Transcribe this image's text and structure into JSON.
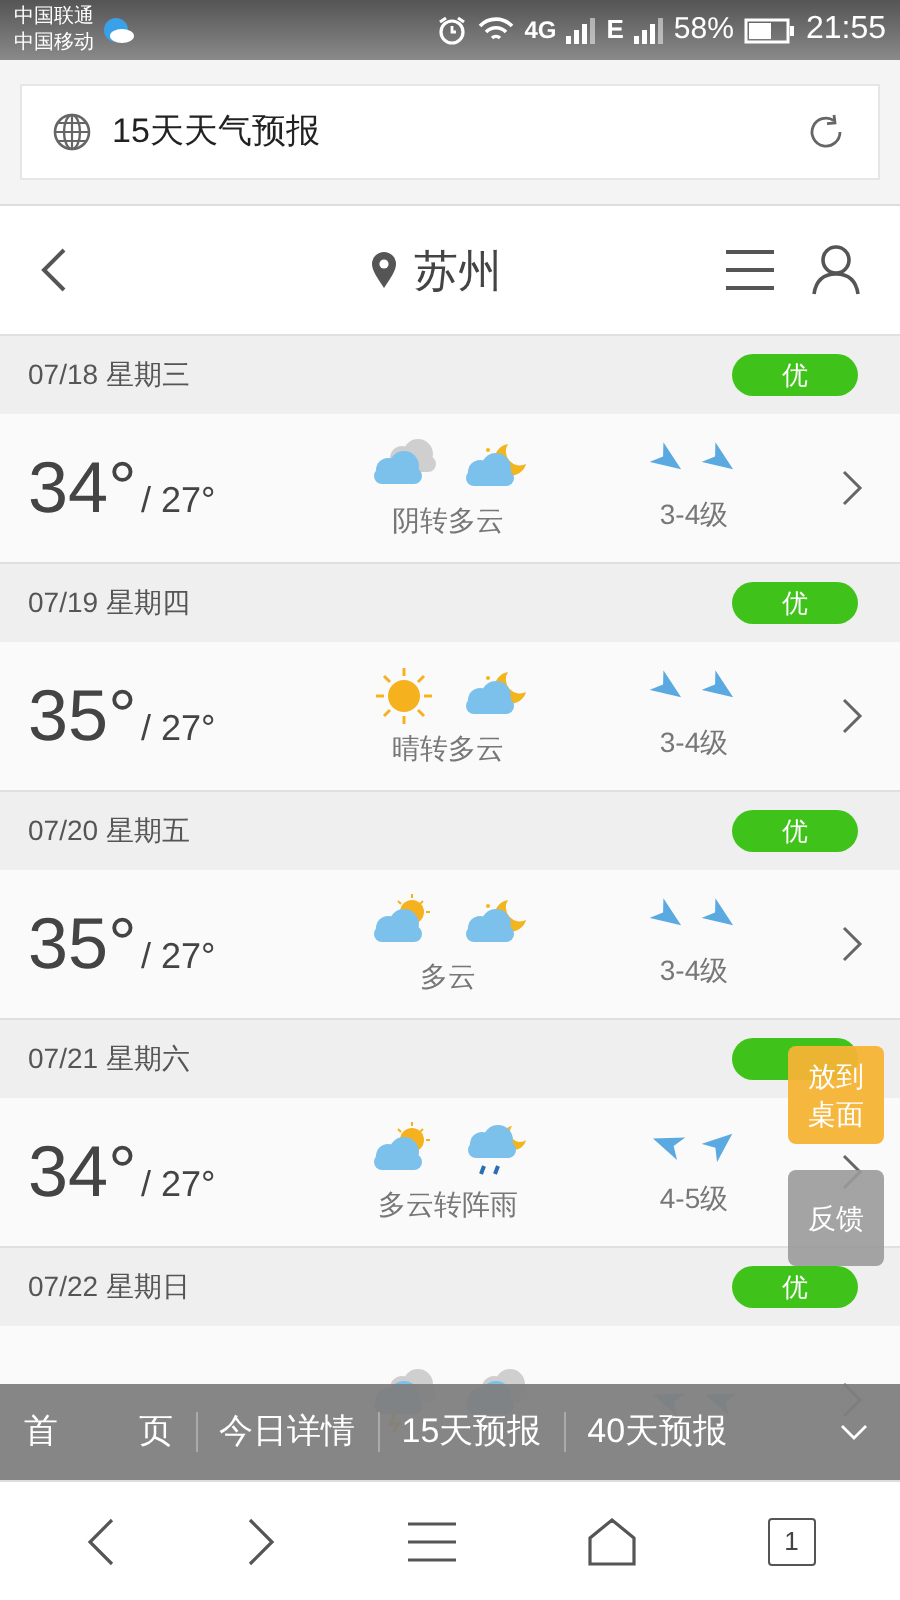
{
  "status_bar": {
    "carriers": [
      "中国联通",
      "中国移动"
    ],
    "network_1": "4G",
    "network_2": "E",
    "battery": "58%",
    "time": "21:55"
  },
  "address_bar": {
    "title": "15天天气预报"
  },
  "header": {
    "city": "苏州"
  },
  "days": [
    {
      "date": "07/18 星期三",
      "aqi": "优",
      "high": "34°",
      "low": "/ 27°",
      "icons": [
        {
          "kind": "overcast"
        },
        {
          "kind": "cloudy_night"
        }
      ],
      "desc": "阴转多云",
      "wind_arrows": [
        {
          "kind": "se"
        },
        {
          "kind": "se"
        }
      ],
      "wind": "3-4级"
    },
    {
      "date": "07/19 星期四",
      "aqi": "优",
      "high": "35°",
      "low": "/ 27°",
      "icons": [
        {
          "kind": "sunny"
        },
        {
          "kind": "cloudy_night"
        }
      ],
      "desc": "晴转多云",
      "wind_arrows": [
        {
          "kind": "se"
        },
        {
          "kind": "se"
        }
      ],
      "wind": "3-4级"
    },
    {
      "date": "07/20 星期五",
      "aqi": "优",
      "high": "35°",
      "low": "/ 27°",
      "icons": [
        {
          "kind": "cloudy_day"
        },
        {
          "kind": "cloudy_night"
        }
      ],
      "desc": "多云",
      "wind_arrows": [
        {
          "kind": "se"
        },
        {
          "kind": "se"
        }
      ],
      "wind": "3-4级"
    },
    {
      "date": "07/21 星期六",
      "high": "34°",
      "low": "/ 27°",
      "icons": [
        {
          "kind": "cloudy_day"
        },
        {
          "kind": "shower"
        }
      ],
      "desc": "多云转阵雨",
      "wind_arrows": [
        {
          "kind": "w"
        },
        {
          "kind": "ne"
        }
      ],
      "wind": "4-5级"
    },
    {
      "date": "07/22 星期日",
      "aqi": "优",
      "icons": [
        {
          "kind": "thunder"
        },
        {
          "kind": "overcast"
        }
      ],
      "wind_arrows": [
        {
          "kind": "w"
        },
        {
          "kind": "w"
        }
      ]
    }
  ],
  "floating_buttons": [
    {
      "label": "放到桌面",
      "kind": "pin"
    },
    {
      "label": "反馈",
      "kind": "feedback"
    }
  ],
  "tab_bar": [
    "首 页",
    "今日详情",
    "15天预报",
    "40天预报"
  ],
  "browser_toolbar": {
    "tab_count": "1"
  }
}
